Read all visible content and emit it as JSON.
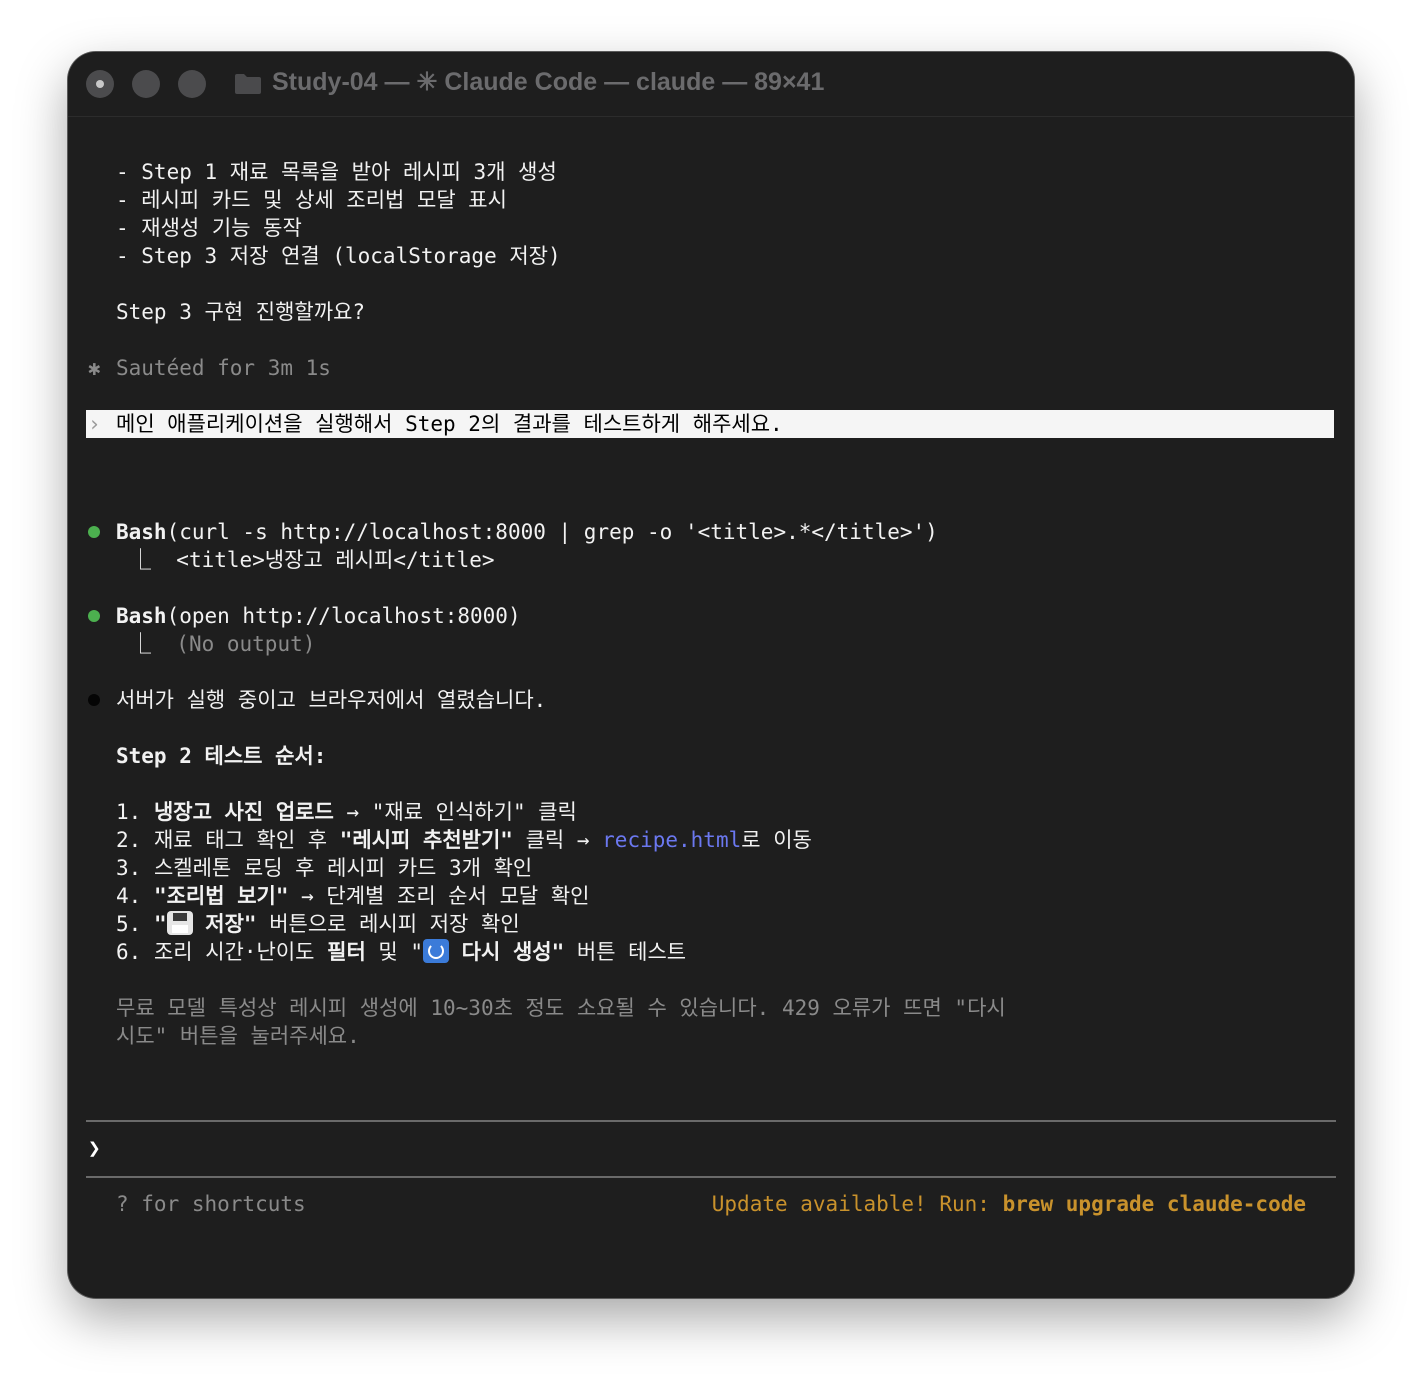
{
  "window": {
    "title": "Study-04 — ✳ Claude Code — claude — 89×41"
  },
  "summary_lines": [
    "- Step 1 재료 목록을 받아 레시피 3개 생성",
    "- 레시피 카드 및 상세 조리법 모달 표시",
    "- 재생성 기능 동작",
    "- Step 3 저장 연결 (localStorage 저장)"
  ],
  "question": "Step 3 구현 진행할까요?",
  "status": {
    "icon": "✱",
    "text": "Sautéed for 3m 1s"
  },
  "user_message": {
    "chevron": "›",
    "text": "메인 애플리케이션을 실행해서 Step 2의 결과를 테스트하게 해주세요."
  },
  "tool_calls": [
    {
      "name": "Bash",
      "args": "(curl -s http://localhost:8000 | grep -o '<title>.*</title>')",
      "result_prefix": "⎿",
      "result": "<title>냉장고 레시피</title>"
    },
    {
      "name": "Bash",
      "args": "(open http://localhost:8000)",
      "result_prefix": "⎿",
      "result": "(No output)"
    }
  ],
  "response": {
    "intro": "서버가 실행 중이고 브라우저에서 열렸습니다.",
    "heading": "Step 2 테스트 순서:",
    "steps": [
      {
        "num": "1.",
        "bold": "냉장고 사진 업로드",
        "rest": " → \"재료 인식하기\" 클릭"
      },
      {
        "num": "2.",
        "pre": "재료 태그 확인 후 ",
        "bold": "\"레시피 추천받기\"",
        "mid": " 클릭 → ",
        "link": "recipe.html",
        "rest": "로 이동"
      },
      {
        "num": "3.",
        "rest": "스켈레톤 로딩 후 레시피 카드 3개 확인"
      },
      {
        "num": "4.",
        "bold": "\"조리법 보기\"",
        "rest": " → 단계별 조리 순서 모달 확인"
      },
      {
        "num": "5.",
        "pre": "\"",
        "emoji": "floppy-disk-icon",
        "bold": " 저장\"",
        "rest": " 버튼으로 레시피 저장 확인"
      },
      {
        "num": "6.",
        "pre": "조리 시간·난이도 ",
        "bold": "필터",
        "mid": " 및 \"",
        "emoji": "refresh-icon",
        "bold2": " 다시 생성\"",
        "rest": " 버튼 테스트"
      }
    ],
    "note_line1": "무료 모델 특성상 레시피 생성에 10~30초 정도 소요될 수 있습니다. 429 오류가 뜨면 \"다시",
    "note_line2": "시도\" 버튼을 눌러주세요."
  },
  "input": {
    "prompt": "❯"
  },
  "footer": {
    "shortcuts": "? for shortcuts",
    "update_prefix": "Update available! Run: ",
    "update_command": "brew upgrade claude-code"
  },
  "colors": {
    "background": "#1e1e1e",
    "bullet_green": "#4cb04f",
    "link": "#6b78f0",
    "update": "#c9922c"
  }
}
